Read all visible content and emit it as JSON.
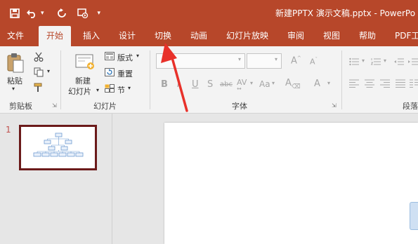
{
  "colors": {
    "accent": "#b7472a",
    "ribbon_bg": "#f3f3f3",
    "thumb_border": "#6b1a1a",
    "arrow": "#e8312a"
  },
  "titlebar": {
    "title": "新建PPTX 演示文稿.pptx  -  PowerPo",
    "qat": [
      {
        "name": "save-icon",
        "glyph": "💾"
      },
      {
        "name": "undo-icon",
        "glyph": "↶"
      },
      {
        "name": "redo-icon",
        "glyph": "↻"
      },
      {
        "name": "start-slideshow-icon",
        "glyph": "▶"
      },
      {
        "name": "customize-qat-icon",
        "glyph": "▾"
      }
    ]
  },
  "tabs": [
    "文件",
    "开始",
    "插入",
    "设计",
    "切换",
    "动画",
    "幻灯片放映",
    "审阅",
    "视图",
    "帮助",
    "PDF工"
  ],
  "active_tab": "开始",
  "ribbon": {
    "clipboard": {
      "paste_label": "粘贴",
      "group_label": "剪贴板"
    },
    "slides": {
      "new_slide_line1": "新建",
      "new_slide_line2": "幻灯片",
      "layout": "版式",
      "reset": "重置",
      "section": "节",
      "group_label": "幻灯片"
    },
    "font": {
      "bold": "B",
      "italic": "I",
      "underline": "U",
      "shadow": "S",
      "strike": "abc",
      "spacing": "AV",
      "case": "Aa",
      "clear_format": "A",
      "font_color": "A",
      "group_label": "字体"
    },
    "paragraph": {
      "group_label": "段落"
    }
  },
  "slides_pane": {
    "slide_number": "1"
  }
}
